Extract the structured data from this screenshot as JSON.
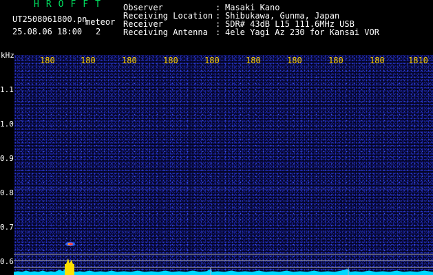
{
  "header": {
    "app_title": "HROFFT",
    "file_name": "UT2508061800.pn",
    "meteor_label": "meteor",
    "date_time": "25.08.06 18:00",
    "meteor_count": "2"
  },
  "station": {
    "rows": [
      {
        "key": "Observer",
        "value": "Masaki Kano"
      },
      {
        "key": "Receiving Location",
        "value": "Shibukawa, Gunma, Japan"
      },
      {
        "key": "Receiver",
        "value": "SDR# 43dB L15 111.6MHz USB"
      },
      {
        "key": "Receiving Antenna",
        "value": "4ele Yagi Az 230 for Kansai VOR"
      }
    ],
    "separator": ":"
  },
  "freq_axis": {
    "unit": "kHz",
    "ticks": [
      "180",
      "180",
      "180",
      "180",
      "180",
      "180",
      "180",
      "180",
      "180",
      "180",
      "1810"
    ]
  },
  "y_axis": {
    "ticks": [
      "1.1",
      "1.0",
      "0.9",
      "0.8",
      "0.7",
      "0.6"
    ]
  },
  "colors": {
    "title": "#00e060",
    "tick_labels": "#ffd200",
    "waterfall_bg": "#050525",
    "noise": "#2a3cd0",
    "spectrum": "#00d8ff",
    "peak": "#ffe000",
    "meteor_echo": "#ff4040"
  }
}
